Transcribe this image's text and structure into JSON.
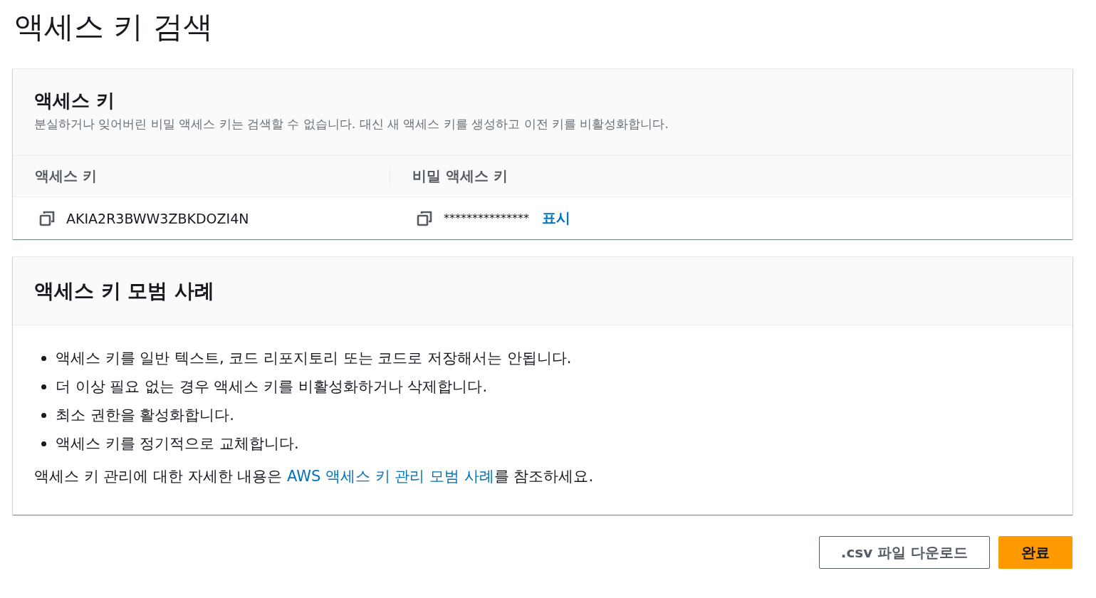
{
  "page": {
    "title": "액세스 키 검색"
  },
  "access_key_panel": {
    "title": "액세스 키",
    "description": "분실하거나 잊어버린 비밀 액세스 키는 검색할 수 없습니다. 대신 새 액세스 키를 생성하고 이전 키를 비활성화합니다.",
    "columns": [
      "액세스 키",
      "비밀 액세스 키"
    ],
    "row": {
      "access_key": "AKIA2R3BWW3ZBKDOZI4N",
      "secret_access_key": "***************",
      "show_link": "표시"
    }
  },
  "best_practices_panel": {
    "title": "액세스 키 모범 사례",
    "items": [
      "액세스 키를 일반 텍스트, 코드 리포지토리 또는 코드로 저장해서는 안됩니다.",
      "더 이상 필요 없는 경우 액세스 키를 비활성화하거나 삭제합니다.",
      "최소 권한을 활성화합니다.",
      "액세스 키를 정기적으로 교체합니다."
    ],
    "footer": {
      "before": "액세스 키 관리에 대한 자세한 내용은 ",
      "link": "AWS 액세스 키 관리 모범 사례",
      "after": "를 참조하세요."
    }
  },
  "buttons": [
    {
      "label": ".csv 파일 다운로드",
      "kind": "secondary"
    },
    {
      "label": "완료",
      "kind": "primary"
    }
  ]
}
